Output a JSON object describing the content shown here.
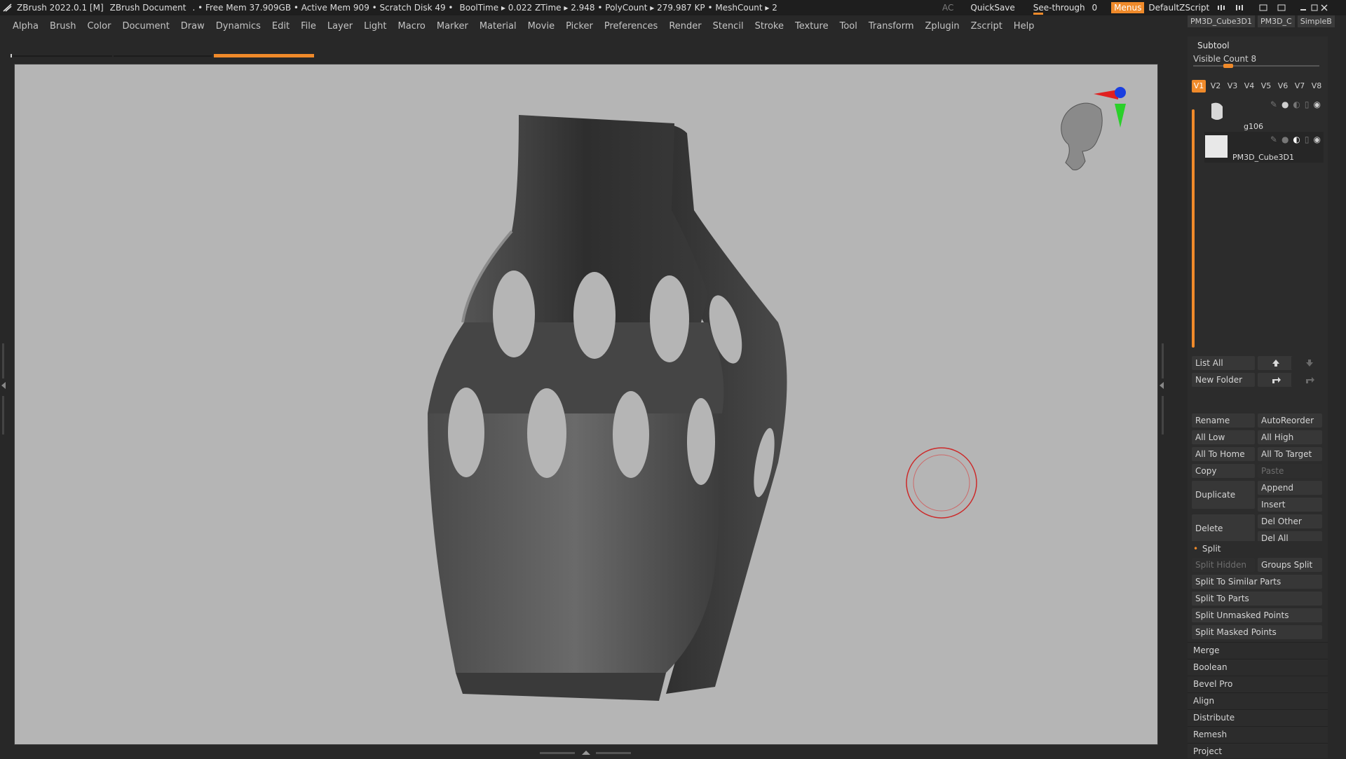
{
  "titlebar": {
    "app": "ZBrush 2022.0.1 [M]",
    "document": "ZBrush Document",
    "stats": [
      ". • Free Mem 37.909GB • Active Mem 909 • Scratch Disk 49 •",
      "BoolTime ▸ 0.022 ZTime ▸ 2.948 • PolyCount ▸ 279.987 KP • MeshCount ▸ 2"
    ],
    "ac": "AC",
    "quicksave": "QuickSave",
    "see_through_label": "See-through",
    "see_through_value": "0",
    "menus": "Menus",
    "script": "DefaultZScript",
    "tool_tabs": [
      "PM3D_Cube3D1",
      "PM3D_C",
      "SimpleB"
    ]
  },
  "menubar": [
    "Alpha",
    "Brush",
    "Color",
    "Document",
    "Draw",
    "Dynamics",
    "Edit",
    "File",
    "Layer",
    "Light",
    "Macro",
    "Marker",
    "Material",
    "Movie",
    "Picker",
    "Preferences",
    "Render",
    "Stencil",
    "Stroke",
    "Texture",
    "Tool",
    "Transform",
    "Zplugin",
    "Zscript",
    "Help"
  ],
  "subtool": {
    "title": "Subtool",
    "visible_count": "Visible Count 8",
    "visible_count_fraction": 0.28,
    "version_tabs": [
      "V1",
      "V2",
      "V3",
      "V4",
      "V5",
      "V6",
      "V7",
      "V8"
    ],
    "active_tab": "V1",
    "items": [
      {
        "name": "g106"
      },
      {
        "name": "PM3D_Cube3D1"
      }
    ]
  },
  "buttons": {
    "list_all": "List All",
    "new_folder": "New Folder",
    "rename": "Rename",
    "autoreorder": "AutoReorder",
    "all_low": "All Low",
    "all_high": "All High",
    "all_to_home": "All To Home",
    "all_to_target": "All To Target",
    "copy": "Copy",
    "paste": "Paste",
    "duplicate": "Duplicate",
    "append": "Append",
    "insert": "Insert",
    "delete": "Delete",
    "del_other": "Del Other",
    "del_all": "Del All"
  },
  "split": {
    "title": "Split",
    "split_hidden": "Split Hidden",
    "groups_split": "Groups Split",
    "split_similar": "Split To Similar Parts",
    "split_parts": "Split To Parts",
    "split_unmasked": "Split Unmasked Points",
    "split_masked": "Split Masked Points"
  },
  "sections": [
    "Merge",
    "Boolean",
    "Bevel Pro",
    "Align",
    "Distribute",
    "Remesh",
    "Project"
  ],
  "colors": {
    "accent": "#f08a2a",
    "viewport_bg": "#b5b5b5",
    "ui_bg": "#282828"
  }
}
